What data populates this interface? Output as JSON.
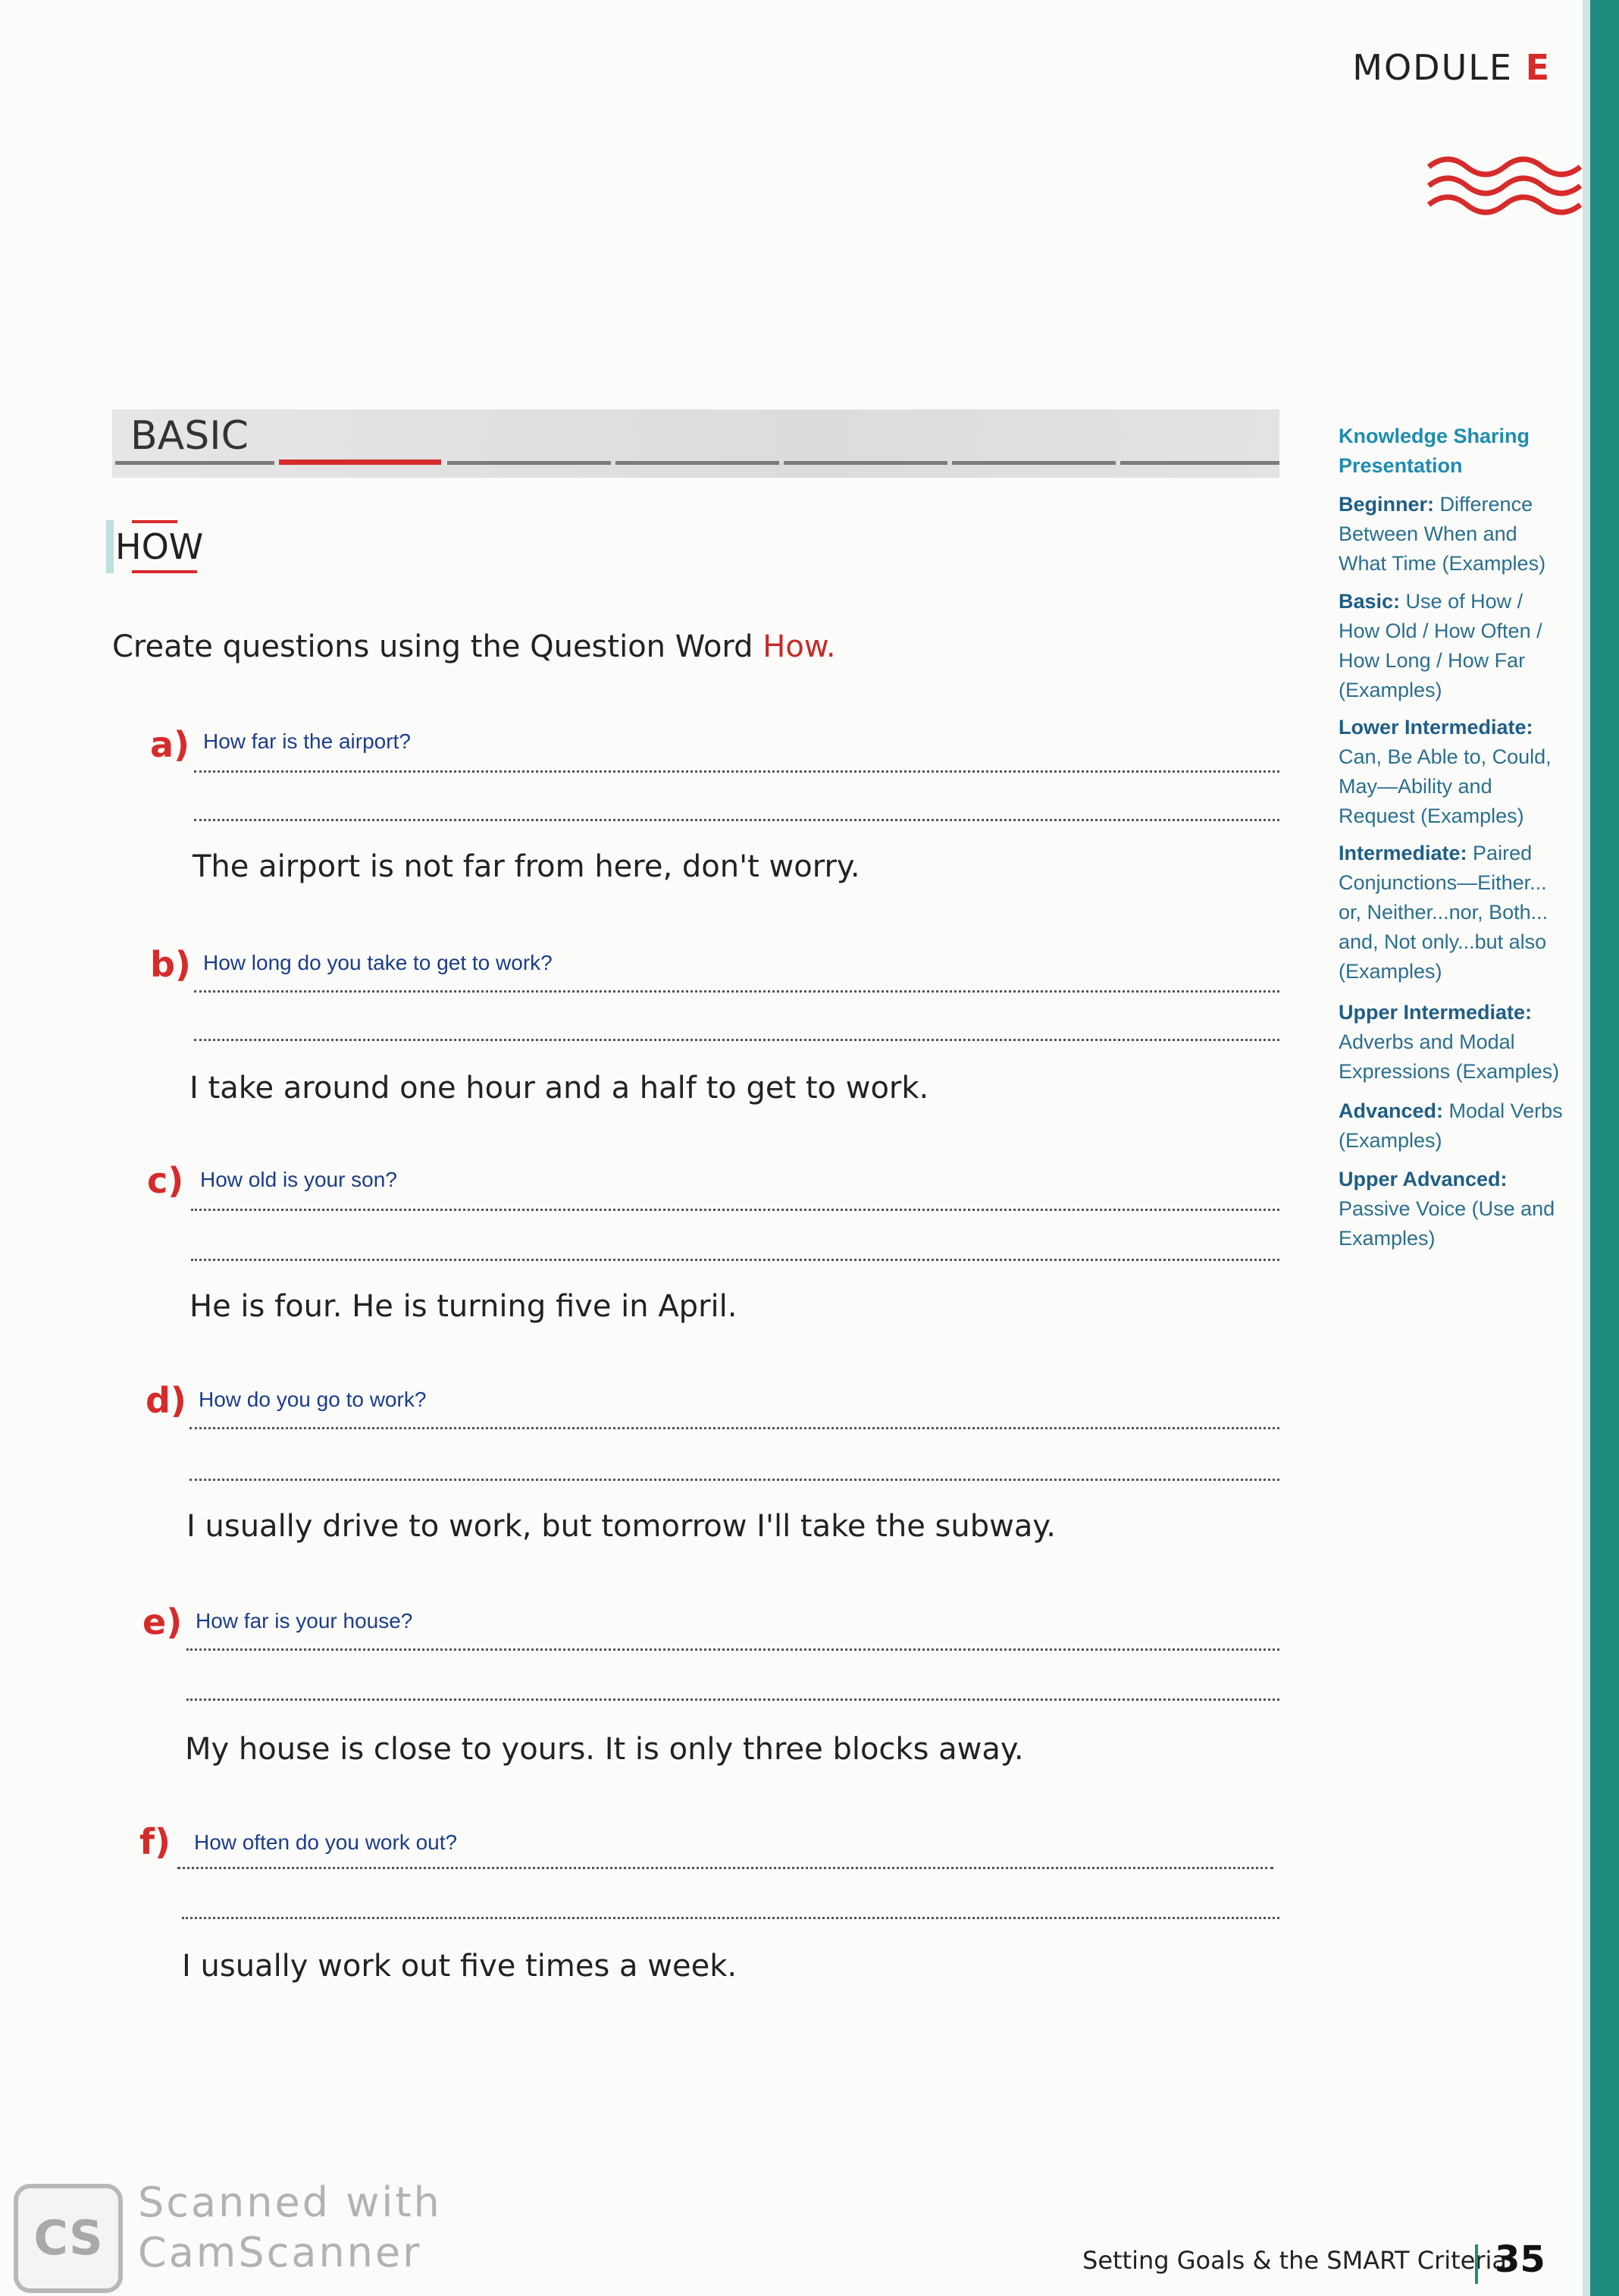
{
  "header": {
    "module_word": "MODULE",
    "module_letter": "E",
    "wave_icon": "wave-lines-icon"
  },
  "section": {
    "title": "BASIC",
    "tag": "HOW"
  },
  "instruction": {
    "text": "Create questions using the Question Word ",
    "accent_word": "How."
  },
  "items": [
    {
      "letter": "a)",
      "answer": "How far is the airport?",
      "response": "The airport is not far from here, don't worry."
    },
    {
      "letter": "b)",
      "answer": "How long do you take to get to work?",
      "response": "I take around one hour and a half to get to work."
    },
    {
      "letter": "c)",
      "answer": "How old is your son?",
      "response": "He is four. He is turning five in April."
    },
    {
      "letter": "d)",
      "answer": "How do you go to work?",
      "response": "I usually drive to work, but tomorrow I'll take the subway."
    },
    {
      "letter": "e)",
      "answer": "How far is your house?",
      "response": "My house is close to yours. It is only three blocks away."
    },
    {
      "letter": "f)",
      "answer": "How often do you work out?",
      "response": "I usually work out five times a week."
    }
  ],
  "sidebar": {
    "knowledge": "Knowledge Sharing Presentation",
    "entries": [
      {
        "level": "Beginner:",
        "text": " Difference Between When and What Time (Examples)"
      },
      {
        "level": "Basic:",
        "text": " Use of How / How Old / How Often / How Long / How Far (Examples)"
      },
      {
        "level": "Lower Intermediate:",
        "text": " Can, Be Able to, Could, May—Ability and Request (Examples)"
      },
      {
        "level": "Intermediate:",
        "text": " Paired Conjunctions—Either... or, Neither...nor, Both... and, Not only...but also (Examples)"
      },
      {
        "level": "Upper Intermediate:",
        "text": " Adverbs and Modal Expressions (Examples)"
      },
      {
        "level": "Advanced:",
        "text": " Modal Verbs (Examples)"
      },
      {
        "level": "Upper Advanced:",
        "text": " Passive Voice (Use and Examples)"
      }
    ]
  },
  "footer": {
    "title": "Setting Goals & the SMART Criteria",
    "page_number": "35"
  },
  "watermark": {
    "logo": "CS",
    "line1": "Scanned with",
    "line2": "CamScanner"
  },
  "colors": {
    "accent_red": "#d62b2b",
    "edge_teal": "#1f8a7e",
    "handwriting_blue": "#1b3d8a",
    "sidebar_blue": "#2a6f8e"
  }
}
